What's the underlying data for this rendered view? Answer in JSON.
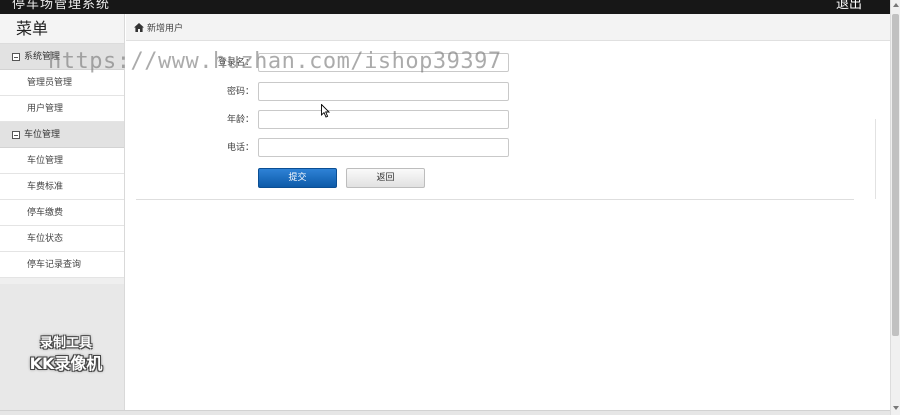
{
  "topbar": {
    "title": "停车场管理系统",
    "logout_label": "退出"
  },
  "sidebar": {
    "menu_title": "菜单",
    "groups": [
      {
        "label": "系统管理",
        "items": [
          {
            "label": "管理员管理"
          },
          {
            "label": "用户管理"
          }
        ]
      },
      {
        "label": "车位管理",
        "items": [
          {
            "label": "车位管理"
          },
          {
            "label": "车费标准"
          },
          {
            "label": "停车缴费"
          },
          {
            "label": "车位状态"
          },
          {
            "label": "停车记录查询"
          }
        ]
      }
    ],
    "recorder_line1": "录制工具",
    "recorder_line2": "KK录像机"
  },
  "breadcrumb": {
    "label": "新增用户"
  },
  "form": {
    "fields": [
      {
        "label": "登录名：",
        "value": ""
      },
      {
        "label": "密码：",
        "value": ""
      },
      {
        "label": "年龄：",
        "value": ""
      },
      {
        "label": "电话：",
        "value": ""
      }
    ],
    "submit_label": "提交",
    "back_label": "返回"
  },
  "watermark": "https://www.huzhan.com/ishop39397",
  "colors": {
    "topbar": "#171717",
    "primary_button": "#1565c0",
    "sidebar": "#efefef"
  }
}
